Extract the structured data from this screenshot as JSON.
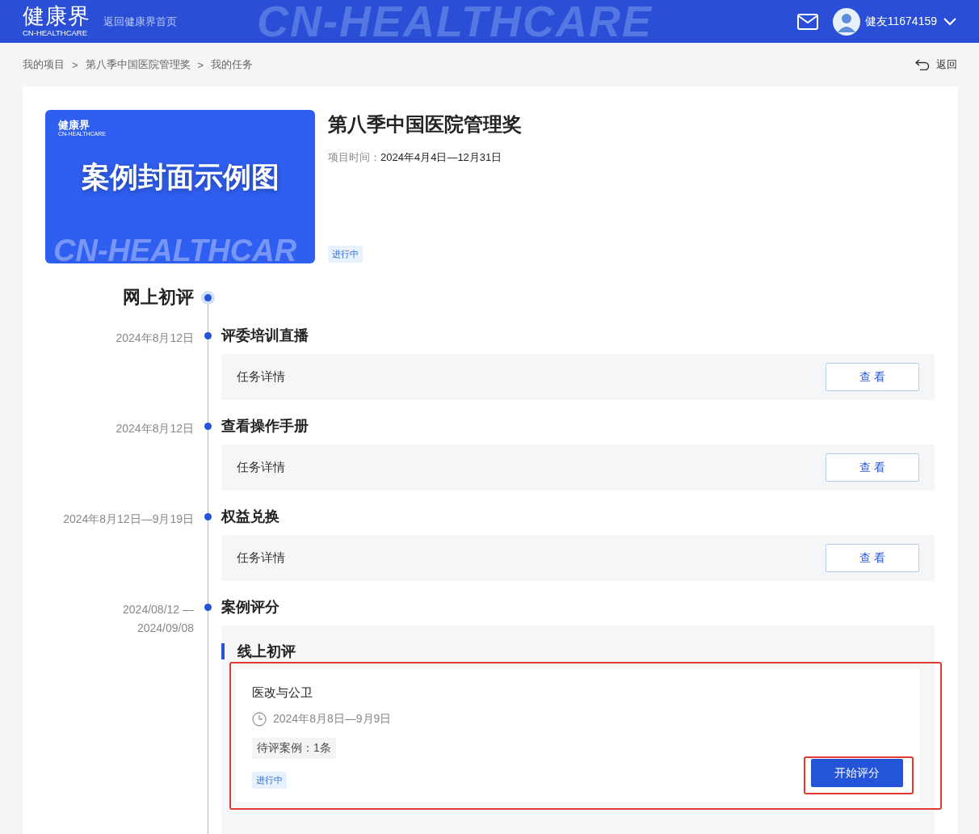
{
  "header": {
    "logo": "健康界",
    "logo_sub": "CN-HEALTHCARE",
    "home_link": "返回健康界首页",
    "backdrop_text": "CN-HEALTHCARE",
    "user": "健友11674159"
  },
  "breadcrumb": {
    "items": [
      "我的项目",
      "第八季中国医院管理奖",
      "我的任务"
    ],
    "separator": ">"
  },
  "back": "返回",
  "project": {
    "cover": {
      "logo": "健康界",
      "logo_sub": "CN-HEALTHCARE",
      "title": "案例封面示例图",
      "backdrop_text": "CN-HEALTHCAR"
    },
    "title": "第八季中国医院管理奖",
    "time_label": "项目时间：",
    "time": "2024年4月4日—12月31日",
    "status": "进行中"
  },
  "stage": {
    "title": "网上初评",
    "tasks": [
      {
        "kind": "detail",
        "date": [
          "2024年8月12日"
        ],
        "title": "评委培训直播",
        "detail": "任务详情",
        "button": "查 看"
      },
      {
        "kind": "detail",
        "date": [
          "2024年8月12日"
        ],
        "title": "查看操作手册",
        "detail": "任务详情",
        "button": "查 看"
      },
      {
        "kind": "detail",
        "date": [
          "2024年8月12日—9月19日"
        ],
        "title": "权益兑换",
        "detail": "任务详情",
        "button": "查 看"
      },
      {
        "kind": "review",
        "date": [
          "2024/08/12 —",
          "2024/09/08"
        ],
        "title": "案例评分",
        "section": "线上初评",
        "cards": [
          {
            "name": "医改与公卫",
            "period": "2024年8月8日—9月9日",
            "pending": "待评案例：1条",
            "status": "进行中",
            "button": "开始评分",
            "highlighted": true,
            "button_highlighted": true
          }
        ]
      }
    ]
  }
}
